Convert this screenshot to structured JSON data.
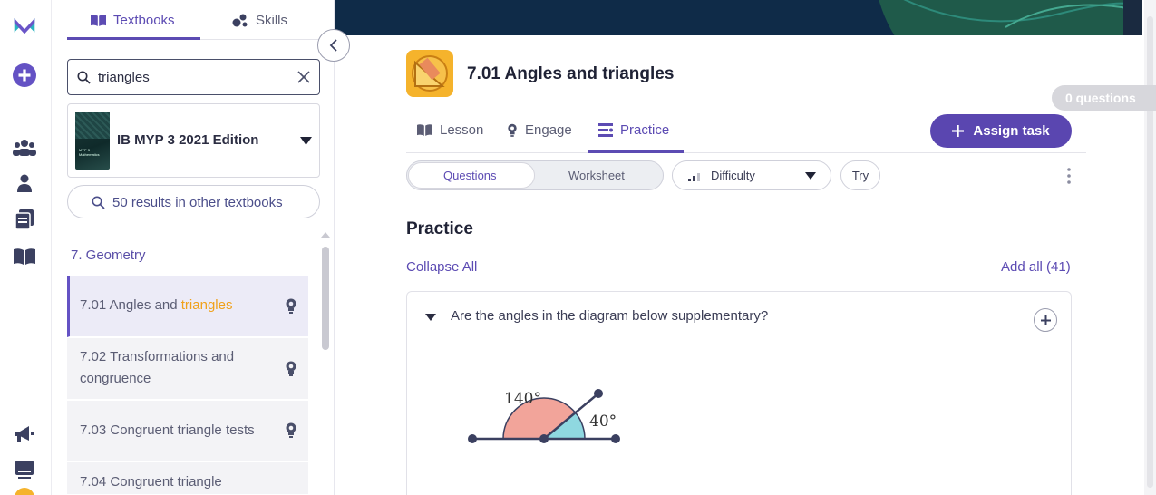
{
  "rail": {
    "icons": [
      "mathspace-logo-icon",
      "add-circle-icon",
      "groups-icon",
      "person-icon",
      "tasks-icon",
      "textbook-icon",
      "announcement-icon",
      "inbox-icon"
    ],
    "brand_color": "#5c4bb3"
  },
  "sidebar": {
    "tabs": [
      {
        "label": "Textbooks",
        "icon": "book-open-icon",
        "active": true
      },
      {
        "label": "Skills",
        "icon": "skills-icon",
        "active": false
      }
    ],
    "search": {
      "value": "triangles",
      "placeholder": ""
    },
    "textbook": {
      "title": "IB MYP 3 2021 Edition",
      "cover_lines": [
        "MYP 3",
        "Mathematics"
      ]
    },
    "other_results": "50 results in other textbooks",
    "chapter": "7. Geometry",
    "lessons": [
      {
        "label_pre": "7.01 Angles and ",
        "label_highlight": "triangles",
        "active": true
      },
      {
        "label": "7.02 Transformations and congruence",
        "active": false
      },
      {
        "label": "7.03 Congruent triangle tests",
        "active": false
      },
      {
        "label": "7.04 Congruent triangle",
        "active": false
      }
    ]
  },
  "main": {
    "question_count": "0 questions",
    "lesson_title": "7.01 Angles and triangles",
    "tabs": [
      {
        "label": "Lesson",
        "icon": "book-open-icon"
      },
      {
        "label": "Engage",
        "icon": "lightbulb-icon"
      },
      {
        "label": "Practice",
        "icon": "practice-icon",
        "active": true
      }
    ],
    "assign_label": "Assign task",
    "segment": {
      "questions": "Questions",
      "worksheet": "Worksheet"
    },
    "difficulty": "Difficulty",
    "try_label": "Try",
    "section_title": "Practice",
    "collapse_all": "Collapse All",
    "add_all": "Add all (41)",
    "question": {
      "text": "Are the angles in the diagram below supplementary?",
      "angle_1": "140°",
      "angle_2": "40°",
      "angle_1_value": 140,
      "angle_2_value": 40
    }
  },
  "colors": {
    "accent": "#5c4bb3",
    "highlight": "#f0a11a",
    "banner": "#0f2b48",
    "angle_1_fill": "#f2a49a",
    "angle_2_fill": "#8fd8e0"
  }
}
